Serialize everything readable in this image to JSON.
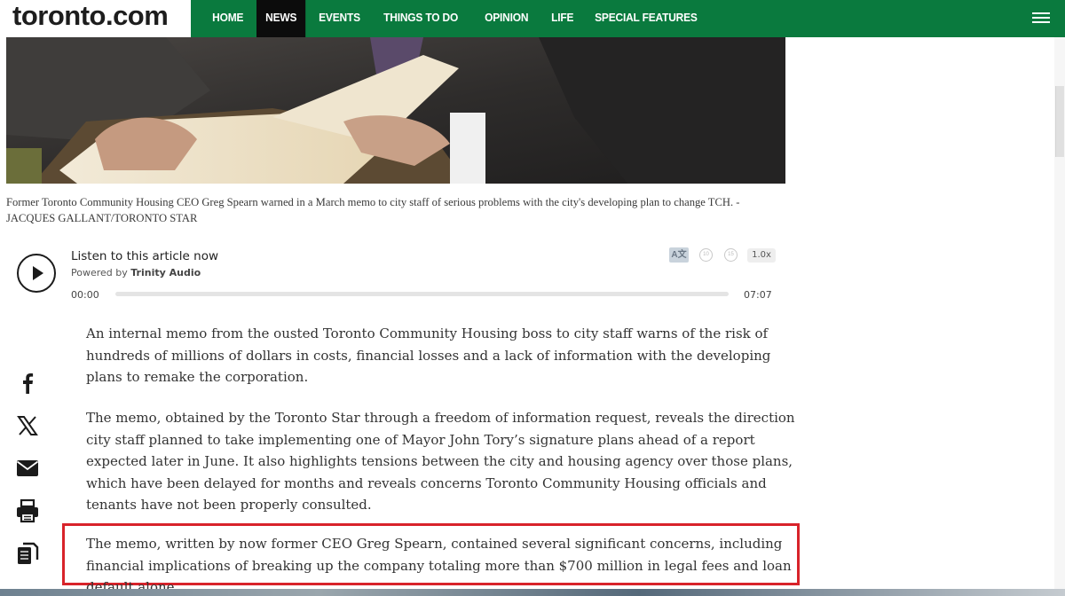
{
  "header": {
    "logo": "toronto.com",
    "nav": [
      "HOME",
      "NEWS",
      "EVENTS",
      "THINGS TO DO",
      "OPINION",
      "LIFE",
      "SPECIAL FEATURES"
    ],
    "active": "NEWS"
  },
  "photo": {
    "caption": "Former Toronto Community Housing CEO Greg Spearn warned in a March memo to city staff of serious problems with the city's developing plan to change TCH. - JACQUES GALLANT/TORONTO STAR"
  },
  "audio": {
    "title": "Listen to this article now",
    "powered_prefix": "Powered by",
    "powered_brand": "Trinity Audio",
    "time_start": "00:00",
    "time_end": "07:07",
    "speed": "1.0x",
    "translate_label": "A文",
    "rewind_label": "10",
    "forward_label": "15",
    "progress": 0
  },
  "article": {
    "paragraphs": [
      "An internal memo from the ousted Toronto Community Housing boss to city staff warns of the risk of hundreds of millions of dollars in costs, financial losses and a lack of information with the developing plans to remake the corporation.",
      "The memo, obtained by the Toronto Star through a freedom of information request, reveals the direction city staff planned to take implementing one of Mayor John Tory’s signature plans ahead of a report expected later in June. It also highlights tensions between the city and housing agency over those plans, which have been delayed for months and reveals concerns Toronto Community Housing officials and tenants have not been properly consulted.",
      "The memo, written by now former CEO Greg Spearn, contained several significant concerns, including financial implications of breaking up the company totaling more than $700 million in legal fees and loan default alone."
    ]
  },
  "share": [
    "facebook-icon",
    "x-icon",
    "mail-icon",
    "print-icon",
    "copy-icon"
  ],
  "colors": {
    "header_green": "#0a7a3e",
    "highlight_red": "#d8232a"
  }
}
